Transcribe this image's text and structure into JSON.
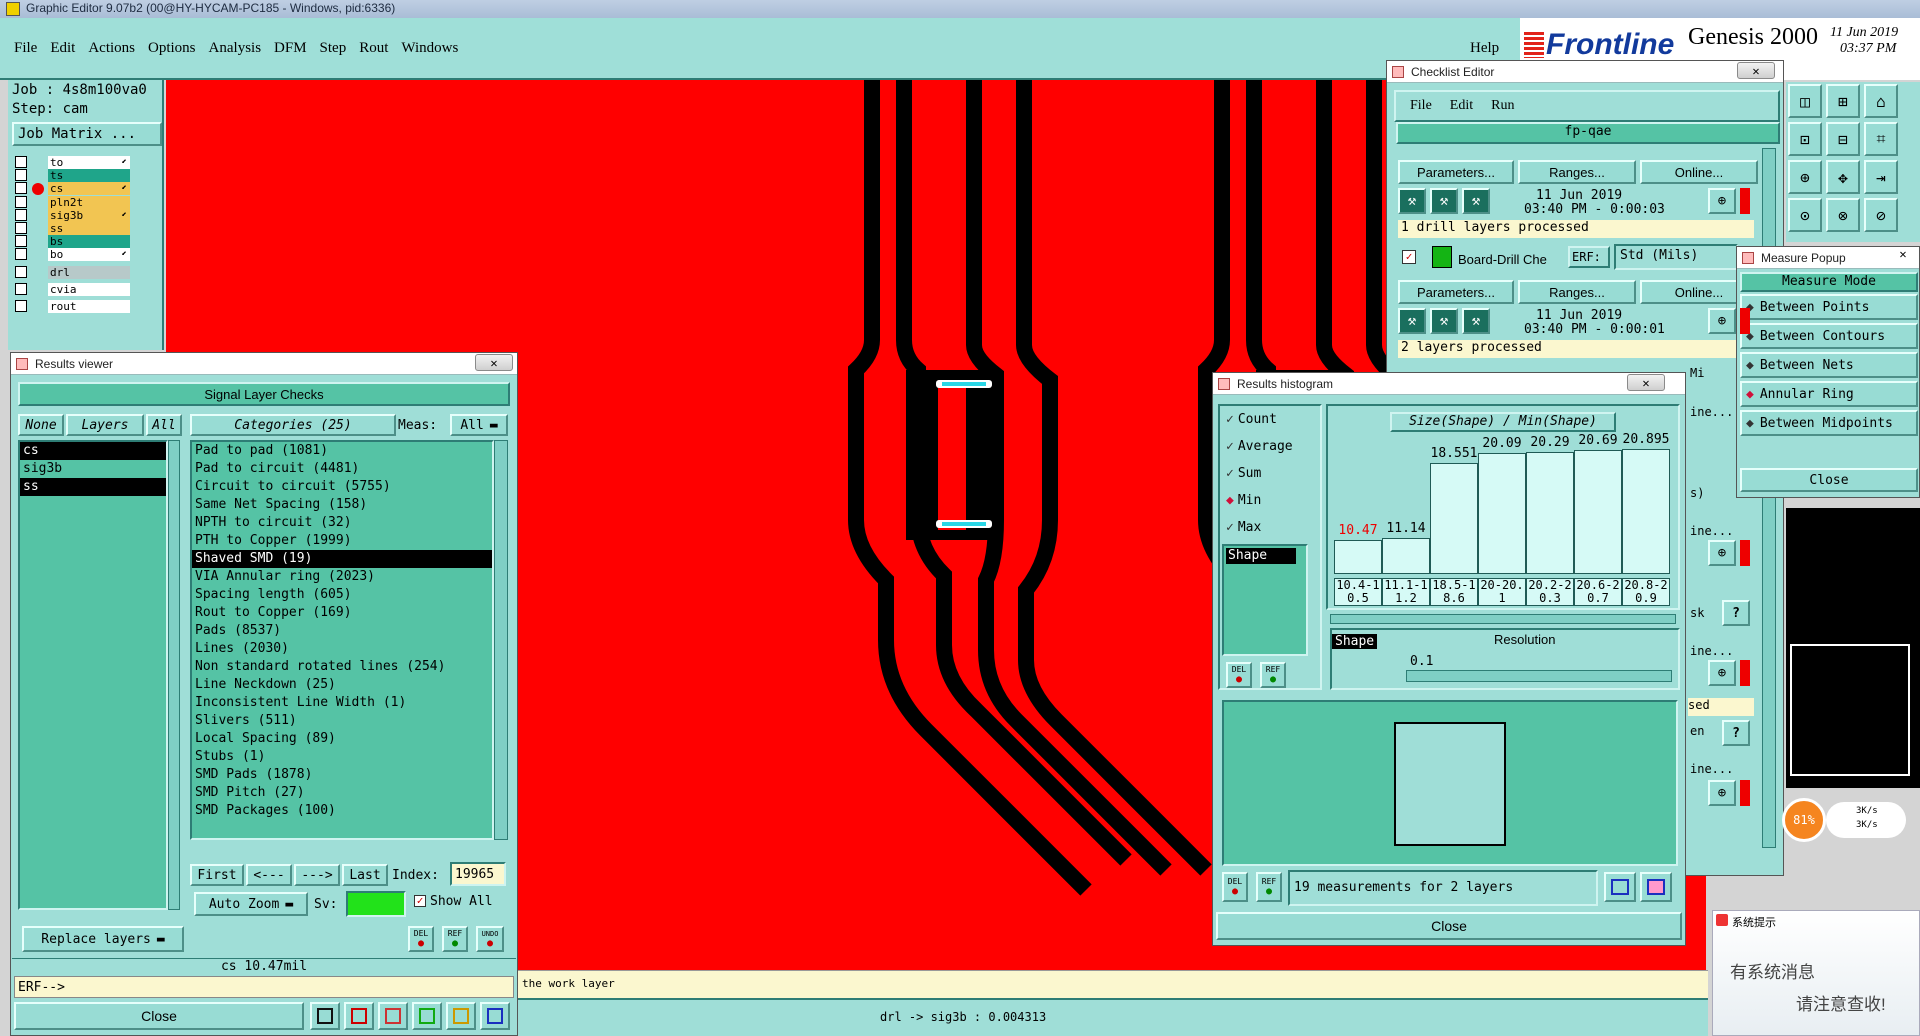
{
  "app": {
    "title": "Graphic Editor 9.07b2 (00@HY-HYCAM-PC185 - Windows, pid:6336)",
    "help": "Help",
    "brand": "Frontline",
    "product": "Genesis 2000",
    "date": "11 Jun 2019",
    "time": "03:37 PM",
    "sub_hidden": "",
    "menu": [
      "File",
      "Edit",
      "Actions",
      "Options",
      "Analysis",
      "DFM",
      "Step",
      "Rout",
      "Windows"
    ]
  },
  "left": {
    "job": "Job : 4s8m100va0",
    "step": "Step: cam",
    "matrix": "Job Matrix ...",
    "layers": [
      {
        "name": "to",
        "color": "#ffffff",
        "arrow": true
      },
      {
        "name": "ts",
        "color": "#1fa58a"
      },
      {
        "name": "cs",
        "color": "#f2c552",
        "arrow": true,
        "active": true
      },
      {
        "name": "pln2t",
        "color": "#f2c552"
      },
      {
        "name": "sig3b",
        "color": "#f2c552",
        "arrow": true
      },
      {
        "name": "ss",
        "color": "#f2c552"
      },
      {
        "name": "bs",
        "color": "#1fa58a"
      },
      {
        "name": "bo",
        "color": "#ffffff",
        "arrow": true
      },
      {
        "name": "drl",
        "color": "#b7c9c9"
      },
      {
        "name": "cvia",
        "color": "#ffffff"
      },
      {
        "name": "rout",
        "color": "#ffffff"
      }
    ]
  },
  "results": {
    "title": "Results viewer",
    "header": "Signal Layer Checks",
    "none": "None",
    "layers_label": "Layers",
    "all": "All",
    "categories_label": "Categories (25)",
    "meas_label": "Meas:",
    "meas_value": "All",
    "layer_list": [
      "cs",
      "sig3b",
      "ss"
    ],
    "categories": [
      "Pad to pad (1081)",
      "Pad to circuit (4481)",
      "Circuit to circuit (5755)",
      "Same Net Spacing (158)",
      "NPTH to circuit (32)",
      "PTH to Copper (1999)",
      "Shaved SMD (19)",
      "VIA Annular ring (2023)",
      "Spacing length (605)",
      "Rout to Copper (169)",
      "Pads (8537)",
      "Lines (2030)",
      "Non standard rotated lines (254)",
      "Line Neckdown (25)",
      "Inconsistent Line Width (1)",
      "Slivers (511)",
      "Local Spacing (89)",
      "Stubs (1)",
      "SMD Pads (1878)",
      "SMD Pitch (27)",
      "SMD Packages (100)"
    ],
    "selected_index": 6,
    "first": "First",
    "prev": "<---",
    "next": "--->",
    "last": "Last",
    "index_label": "Index:",
    "index_value": "19965",
    "auto_zoom": "Auto Zoom",
    "sv": "Sv:",
    "show_all": "Show All",
    "replace_layers": "Replace layers",
    "del": "DEL",
    "ref": "REF",
    "undo": "UNDO",
    "status": "cs 10.47mil",
    "erf": "ERF-->",
    "close": "Close"
  },
  "canvas": {
    "hint": "the work layer",
    "status": "drl -> sig3b : 0.004313",
    "bg": "#ff0000"
  },
  "checklist": {
    "title": "Checklist Editor",
    "menu": [
      "File",
      "Edit",
      "Run"
    ],
    "name": "fp-qae",
    "block1": {
      "params": "Parameters...",
      "ranges": "Ranges...",
      "online": "Online...",
      "date": "11 Jun 2019",
      "time": "03:40 PM - 0:00:03",
      "status": "1 drill layers processed"
    },
    "board_drill": "Board-Drill Che",
    "erf": "ERF:",
    "std": "Std (Mils)",
    "block2": {
      "params": "Parameters...",
      "ranges": "Ranges...",
      "online": "Online...",
      "date": "11 Jun 2019",
      "time": "03:40 PM - 0:00:01",
      "status": "2 layers processed"
    },
    "frag": {
      "mi": "Mi",
      "ine1": "ine...",
      "s": "s)",
      "ine2": "ine...",
      "sk": "sk",
      "ine3": "ine...",
      "sed": "sed",
      "en": "en",
      "ine4": "ine..."
    }
  },
  "measure": {
    "title": "Measure Popup",
    "mode": "Measure Mode",
    "options": [
      "Between Points",
      "Between Contours",
      "Between Nets",
      "Annular Ring",
      "Between Midpoints"
    ],
    "selected": 3,
    "close": "Close"
  },
  "histogram": {
    "title": "Results histogram",
    "toggles": [
      "Count",
      "Average",
      "Sum",
      "Min",
      "Max"
    ],
    "selected_toggle": 3,
    "shape_item": "Shape",
    "heading": "Size(Shape) / Min(Shape)",
    "bars": [
      {
        "label": "10.47",
        "value": 10.47,
        "range": "10.4-10.5",
        "highlight": true
      },
      {
        "label": "11.14",
        "value": 11.14,
        "range": "11.1-11.2"
      },
      {
        "label": "18.551",
        "value": 18.551,
        "range": "18.5-18.6"
      },
      {
        "label": "20.09",
        "value": 20.09,
        "range": "20-20.1"
      },
      {
        "label": "20.29",
        "value": 20.29,
        "range": "20.2-20.3"
      },
      {
        "label": "20.69",
        "value": 20.69,
        "range": "20.6-20.7"
      },
      {
        "label": "20.895",
        "value": 20.895,
        "range": "20.8-20.9"
      }
    ],
    "shape_tag": "Shape",
    "resolution_label": "Resolution",
    "resolution_value": "0.1",
    "summary": "19 measurements for 2 layers",
    "close": "Close",
    "del": "DEL",
    "ref": "REF"
  },
  "tray": {
    "cpu": "81%",
    "up": "3K/s",
    "down": "3K/s",
    "notice_title": "系统提示",
    "notice_line1": "有系统消息",
    "notice_line2": "请注意查收!"
  }
}
